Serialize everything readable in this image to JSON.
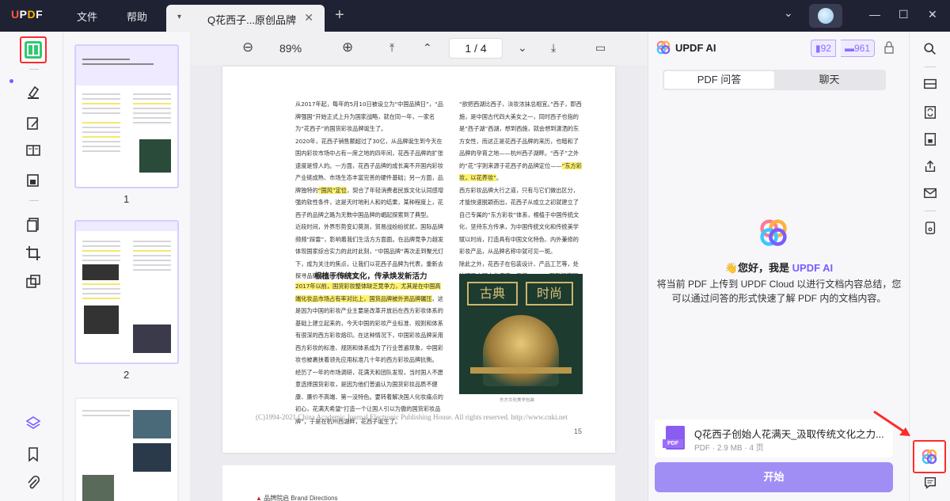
{
  "titlebar": {
    "logo": "UPDF",
    "menu_file": "文件",
    "menu_help": "帮助",
    "tab_title": "Q花西子...原创品牌",
    "tab_dropdown": "▾",
    "tab_close": "✕",
    "new_tab": "+",
    "window_dropdown": "⌄",
    "minimize": "—",
    "maximize": "☐",
    "close": "✕"
  },
  "doc_toolbar": {
    "zoom_out": "⊖",
    "zoom_value": "89%",
    "zoom_in": "⊕",
    "first_page": "⤒",
    "prev_page": "⌃",
    "page_current": "1",
    "page_sep": "/",
    "page_total": "4",
    "next_page": "⌄",
    "last_page": "⤓",
    "present": "▭"
  },
  "thumbnails": [
    {
      "page": "1"
    },
    {
      "page": "2"
    }
  ],
  "page": {
    "col_left_top": "从2017年起，每年的5月10日被设立为“中国品牌日”，“品牌强国”开始正式上升为国家战略，就在同一年，一家名为“花西子”的国货彩妆品牌诞生了。\n2020年，花西子销售额超过了30亿，从品牌诞生到今天在国内彩妆市场中占有一席之地的四年间，花西子品牌的扩张速度是惊人的。一方面，花西子品牌的成长离不开国内彩妆产业链成熟、市场生态丰富完善的硬件基础；另一方面，品牌独特的",
    "col_left_hl1": "“国风”定位",
    "col_left_mid": "，契合了年轻消费者民族文化认同感增强的软性条件，这是天时地利人和的结果，某种程度上，花西子的品牌之路为无数中国品牌的崛起探索到了典型。\n近段时间，外界形势变幻莫测，贸易战纷纷扰扰，国际品牌频频“踩雷”，影响着我们生活方方面面。在品牌竞争力越发体现国家综合实力的此时此刻，“中国品牌”再次走到聚光灯下，成为关注的焦点，让我们以花西子品牌为代表，重新去探寻品牌成长的力量来源。",
    "section_title": "根植于传统文化，传承焕发新活力",
    "col_left_hl2": "2017年以前，国货彩妆整体缺乏竞争力，尤其是在中国高端化妆品市场占有率对比上，国货品牌被外资品牌碾压",
    "col_left_bot": "，这是因为中国的彩妆产业主要是改革开放后在西方彩妆体系的基础上建立起来的，今天中国的彩妆产业标准、规则和体系有很深的西方彩妆烙印。在这种情况下，中国彩妆品牌采用西方彩妆的标准、规则和体系成为了行业普遍现象，中国彩妆也被裹挟着领先应用标准几十年的西方彩妆品牌抗衡。\n经历了一年的市场调研，花满天和团队发现，当时国人不愿意选择国货彩妆，是因为他们普遍认为国货彩妆品质不健康、廉价不高端、第一没特色。要转着解决国人化妆痛点的初心，花满天希望“打造一个让国人引以为傲的国货彩妆品牌”，于是在杭州西湖畔，花西子诞生了。",
    "col_right_top": "“欲把西湖比西子，淡妆浓抹总相宜。”西子，即西施，是中国古代四大美女之一，同时西子也指的是“西子湖”西湖，想到西施，就会想到潇洒的东方女性，而这正是花西子品牌的来历，也暗和了品牌的孕育之地——杭州西子湖畔。“西子”之外的“花”字则来源于花西子的品牌定位——",
    "col_right_hl": "“东方彩妆，以花养妆”",
    "col_right_bot": "。\n西方彩妆品牌大行之道，只有与它们做出区分，才能快速脱颖而出，花西子从成立之初就建立了自己专属的“东方彩妆”体系，根植于中国传统文化，坚持东方传承，为中国传统文化和传统美学赋以时尚，打造具有中国文化特色、内外兼修的彩妆产品，从品牌名称中就可见一斑。\n除此之外，花西子在包装设计、产品工艺等，处处可见中国文化痕迹：品牌LOGO、取形江南园林",
    "poster_left": "古典",
    "poster_right": "时尚",
    "caption": "东方文化美学包装",
    "footer": "(C)1994-2021 China Academic Journal Electronic Publishing House. All rights reserved.    http://www.cnki.net",
    "page_number": "15",
    "page2_head": "品牌院启 Brand Directions"
  },
  "ai_panel": {
    "title": "UPDF AI",
    "badge_pdf": "92",
    "badge_chat": "961",
    "tab_pdf_qa": "PDF 问答",
    "tab_chat": "聊天",
    "greeting_prefix": "👋您好，我是 ",
    "greeting_name": "UPDF AI",
    "intro": "将当前 PDF 上传到 UPDF Cloud 以进行文档内容总结，您可以通过问答的形式快速了解 PDF 内的文档内容。",
    "file_name": "Q花西子创始人花满天_汲取传统文化之力...",
    "file_meta": "PDF · 2.9 MB · 4 页",
    "file_badge": "PDF",
    "start_button": "开始"
  },
  "colors": {
    "titlebar_bg": "#1f2233",
    "accent_purple": "#7b5cff",
    "start_button": "#a08ef5",
    "highlight": "#fff26b",
    "annotation_red": "#ff2b2b",
    "active_tool_green": "#2fc872"
  }
}
